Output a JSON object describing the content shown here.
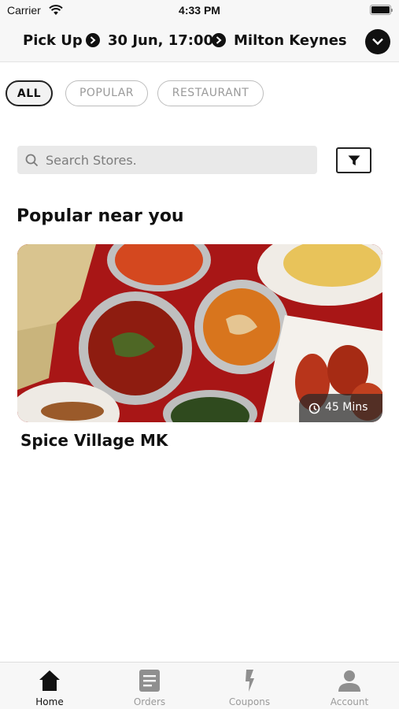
{
  "status_bar": {
    "carrier": "Carrier",
    "time": "4:33 PM"
  },
  "header": {
    "mode": "Pick Up",
    "datetime": "30 Jun, 17:00",
    "location": "Milton Keynes"
  },
  "filters": [
    {
      "label": "ALL",
      "active": true
    },
    {
      "label": "POPULAR",
      "active": false
    },
    {
      "label": "RESTAURANT",
      "active": false
    }
  ],
  "search": {
    "placeholder": "Search Stores."
  },
  "section_title": "Popular near you",
  "stores": [
    {
      "name": "Spice Village MK",
      "eta": "45 Mins"
    }
  ],
  "tabs": [
    {
      "label": "Home",
      "icon": "home-icon",
      "active": true
    },
    {
      "label": "Orders",
      "icon": "orders-icon",
      "active": false
    },
    {
      "label": "Coupons",
      "icon": "coupons-icon",
      "active": false
    },
    {
      "label": "Account",
      "icon": "account-icon",
      "active": false
    }
  ],
  "colors": {
    "accent": "#111111",
    "inactive": "#9a9a9a",
    "card_bg": "#a81616"
  }
}
